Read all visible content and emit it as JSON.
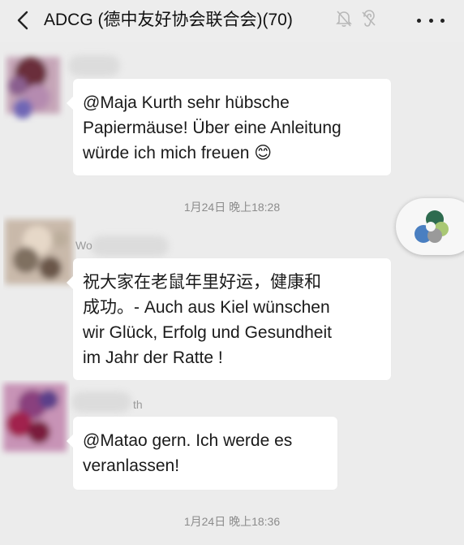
{
  "header": {
    "title": "ADCG (德中友好协会联合会)(70)",
    "icons": [
      "back-icon",
      "mute-icon",
      "ear-icon",
      "more-icon"
    ]
  },
  "messages": [
    {
      "id": "msg1",
      "sender_name": "",
      "lines": [
        "@Maja Kurth  sehr hübsche",
        "Papiermäuse! Über eine Anleitung",
        "würde ich mich freuen 😊"
      ]
    },
    {
      "id": "msg2",
      "sender_name": "Wo",
      "lines": [
        "祝大家在老鼠年里好运，健康和",
        "成功。-  Auch aus Kiel wünschen",
        "wir Glück, Erfolg und Gesundheit",
        "im Jahr der Ratte !"
      ]
    },
    {
      "id": "msg3",
      "sender_name": "th",
      "lines": [
        "@Matao gern. Ich werde es",
        "veranlassen!"
      ]
    }
  ],
  "timestamps": [
    "1月24日 晚上18:28",
    "1月24日 晚上18:36"
  ],
  "floating_button": {
    "icon": "mini-program-logo-icon"
  },
  "colors": {
    "background": "#ececec",
    "bubble": "#ffffff",
    "timestamp_text": "#8c8c8c",
    "logo_green": "#2e6b4f",
    "logo_blue": "#4a7fc1",
    "logo_light_green": "#a9c874",
    "logo_gray": "#9a9a9a"
  }
}
